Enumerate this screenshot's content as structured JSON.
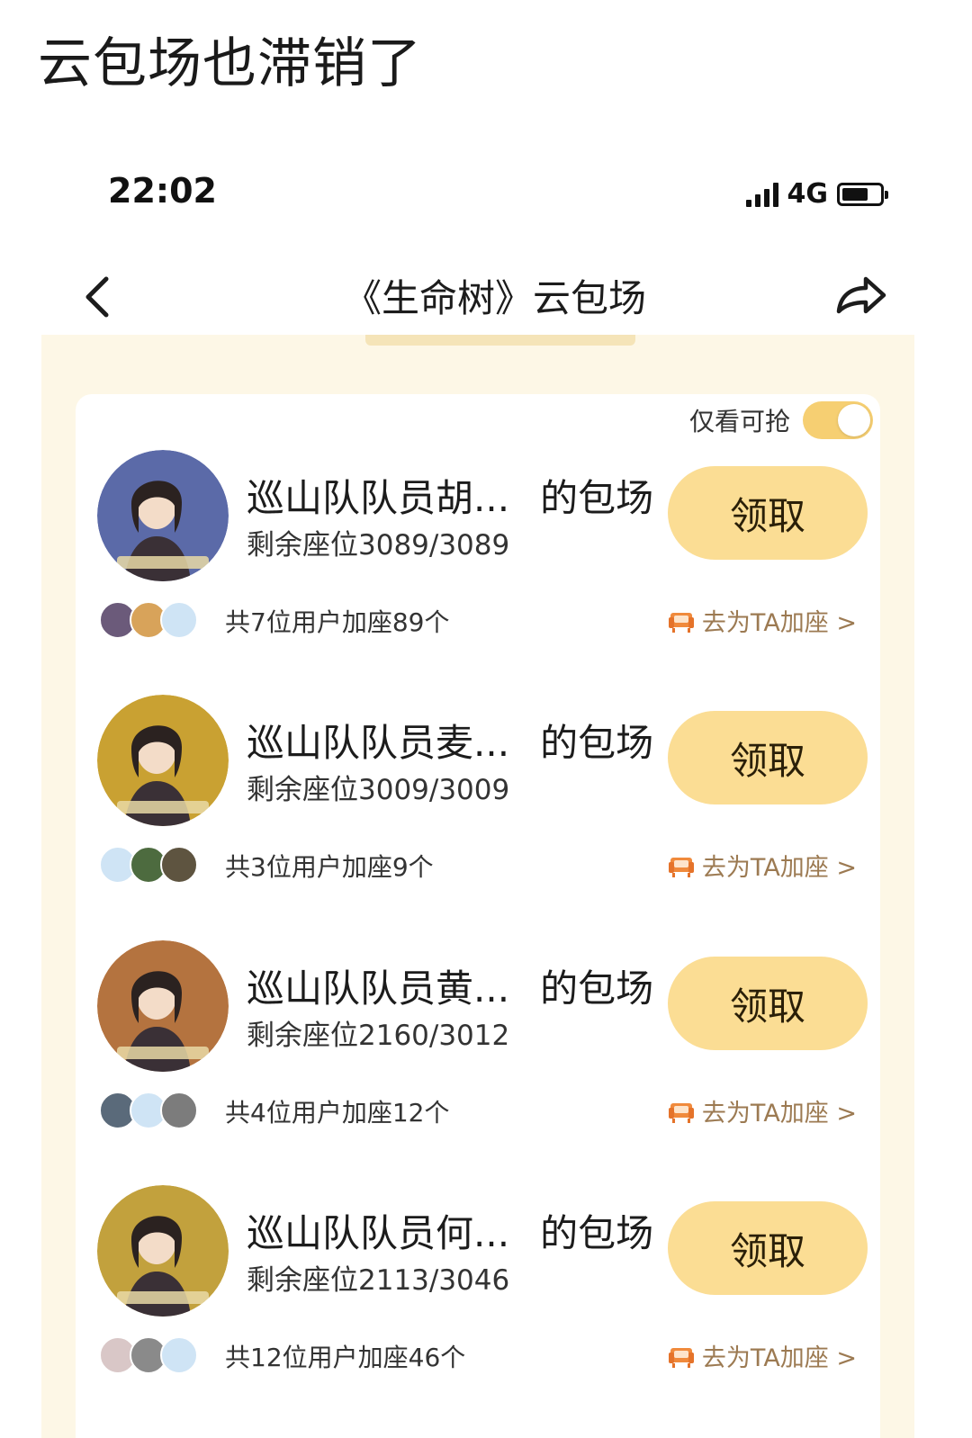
{
  "post": {
    "caption": "云包场也滞销了"
  },
  "status_bar": {
    "time": "22:02",
    "network": "4G"
  },
  "nav": {
    "title": "《生命树》云包场"
  },
  "filter": {
    "label": "仅看可抢",
    "enabled": true
  },
  "items": [
    {
      "title": "巡山队队员胡...",
      "suffix": "的包场",
      "seats": "剩余座位3089/3089",
      "claim_label": "领取",
      "joined": "共7位用户加座89个",
      "add_seat_label": "去为TA加座 >",
      "poster_color": "#5b6aa8",
      "avatar_colors": [
        "#6b5a7a",
        "#d8a35a",
        "#cfe4f5"
      ]
    },
    {
      "title": "巡山队队员麦...",
      "suffix": "的包场",
      "seats": "剩余座位3009/3009",
      "claim_label": "领取",
      "joined": "共3位用户加座9个",
      "add_seat_label": "去为TA加座 >",
      "poster_color": "#c9a132",
      "avatar_colors": [
        "#cfe4f5",
        "#4d6b3f",
        "#5e5440"
      ]
    },
    {
      "title": "巡山队队员黄...",
      "suffix": "的包场",
      "seats": "剩余座位2160/3012",
      "claim_label": "领取",
      "joined": "共4位用户加座12个",
      "add_seat_label": "去为TA加座 >",
      "poster_color": "#b4733f",
      "avatar_colors": [
        "#5a6a7a",
        "#cfe4f5",
        "#7c7c7c"
      ]
    },
    {
      "title": "巡山队队员何...",
      "suffix": "的包场",
      "seats": "剩余座位2113/3046",
      "claim_label": "领取",
      "joined": "共12位用户加座46个",
      "add_seat_label": "去为TA加座 >",
      "poster_color": "#c2a13d",
      "avatar_colors": [
        "#d9c7c7",
        "#8a8a8a",
        "#cfe4f5"
      ]
    }
  ],
  "colors": {
    "accent": "#fbdd94",
    "toggle": "#f6cf72",
    "panel_bg": "#fdf7e6",
    "link": "#9c7a52"
  }
}
